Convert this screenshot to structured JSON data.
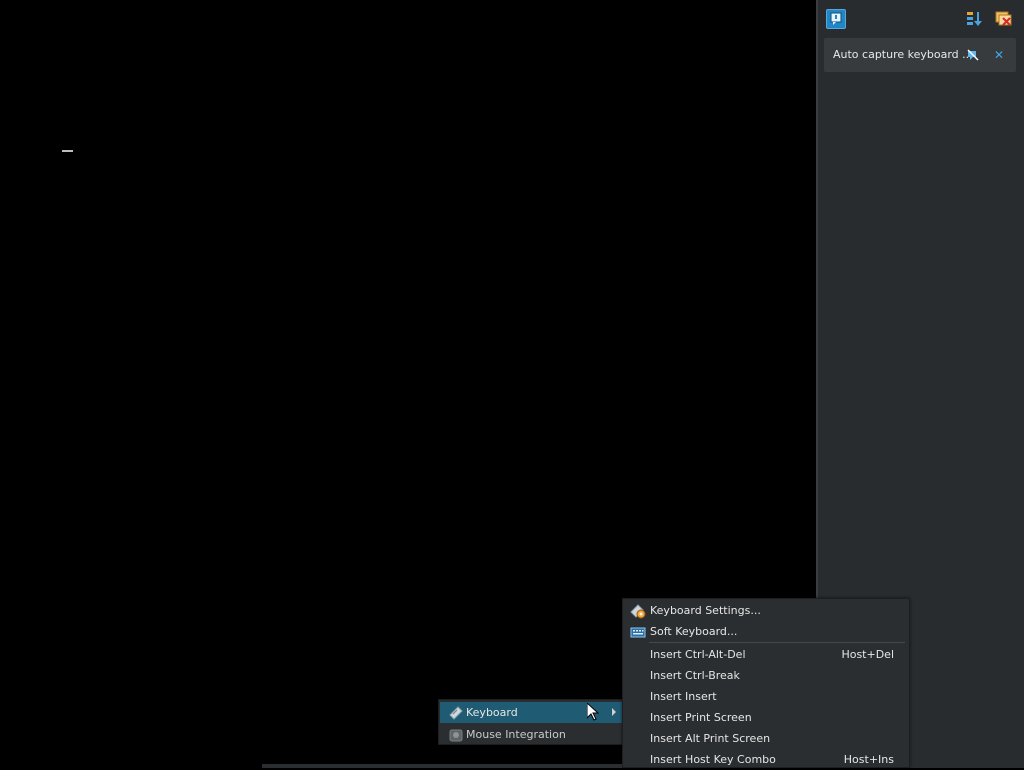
{
  "notification_panel": {
    "notice_text": "Auto capture keyboard ...",
    "toolbar_icons": [
      "notification-center-icon",
      "sort-icon",
      "clear-all-icon"
    ]
  },
  "menu": {
    "items": [
      {
        "label": "Keyboard",
        "icon": "keyboard-icon",
        "has_submenu": true,
        "highlighted": true
      },
      {
        "label": "Mouse Integration",
        "icon": "mouse-integration-icon",
        "has_submenu": false,
        "highlighted": false
      }
    ]
  },
  "submenu": {
    "items": [
      {
        "label": "Keyboard Settings...",
        "icon": "keyboard-settings-icon",
        "shortcut": ""
      },
      {
        "label": "Soft Keyboard...",
        "icon": "soft-keyboard-icon",
        "shortcut": ""
      },
      {
        "label": "Insert Ctrl-Alt-Del",
        "icon": "",
        "shortcut": "Host+Del"
      },
      {
        "label": "Insert Ctrl-Break",
        "icon": "",
        "shortcut": ""
      },
      {
        "label": "Insert Insert",
        "icon": "",
        "shortcut": ""
      },
      {
        "label": "Insert Print Screen",
        "icon": "",
        "shortcut": ""
      },
      {
        "label": "Insert Alt Print Screen",
        "icon": "",
        "shortcut": ""
      },
      {
        "label": "Insert Host Key Combo",
        "icon": "",
        "shortcut": "Host+Ins"
      }
    ]
  },
  "colors": {
    "highlight": "#1f5b73",
    "menu_bg": "#2b2e31",
    "panel_bg": "#292c2e",
    "accent": "#3fa8e8"
  }
}
